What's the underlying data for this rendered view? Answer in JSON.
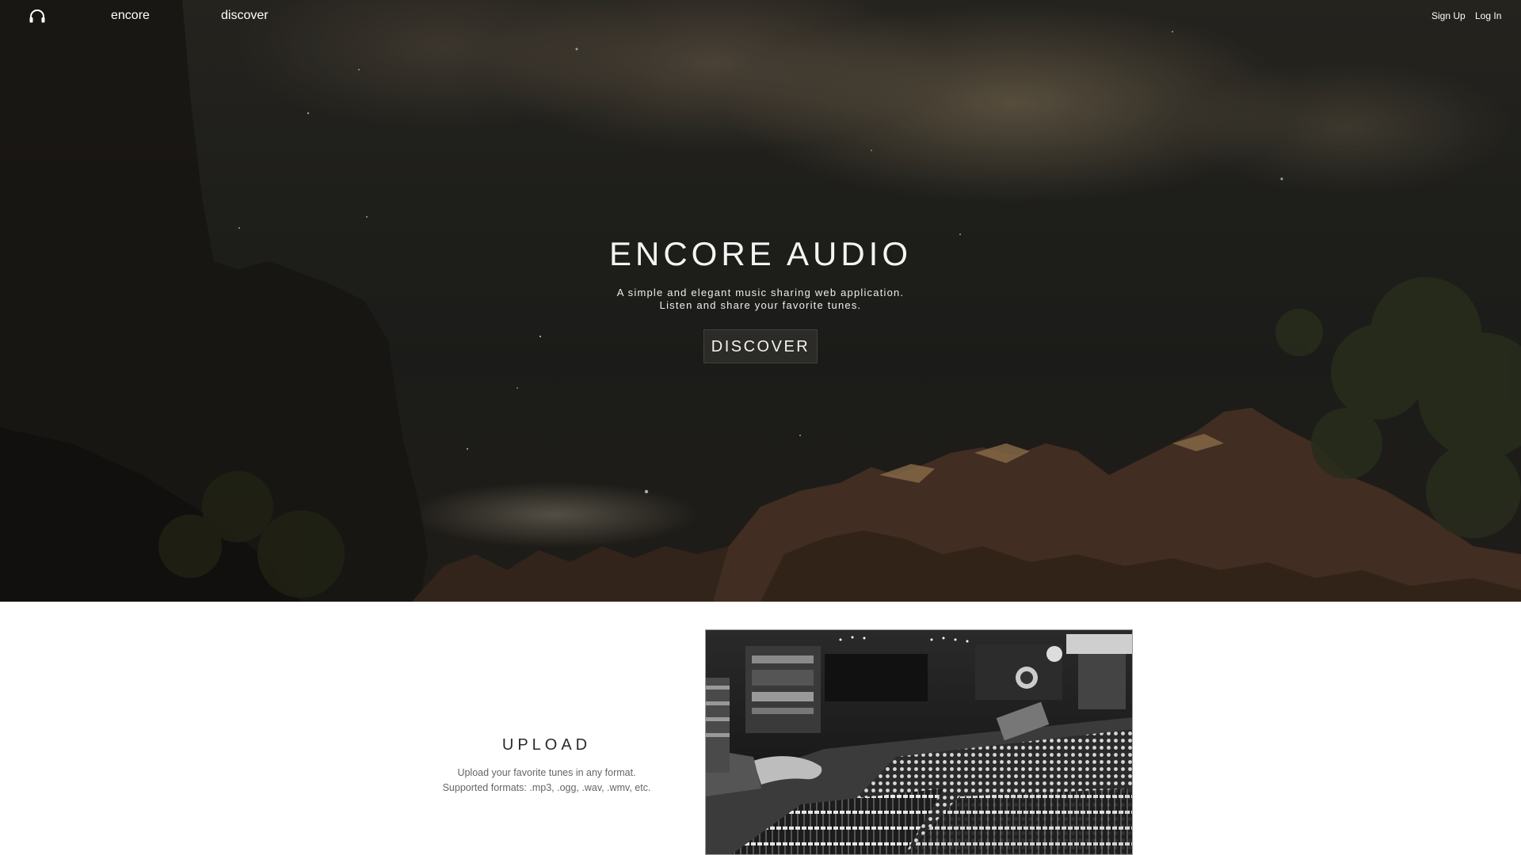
{
  "nav": {
    "logo_icon": "headphones-icon",
    "brand": "encore",
    "discover": "discover",
    "signup": "Sign Up",
    "login": "Log In"
  },
  "hero": {
    "title": "ENCORE AUDIO",
    "subtitle_line1": "A simple and elegant music sharing web application.",
    "subtitle_line2": "Listen and share your favorite tunes.",
    "button": "DISCOVER"
  },
  "upload": {
    "title": "UPLOAD",
    "desc_line1": "Upload your favorite tunes in any format.",
    "desc_line2": "Supported formats: .mp3, .ogg, .wav, .wmv, etc."
  },
  "colors": {
    "text_light": "#ffffff",
    "upload_title": "#2a2a2a",
    "upload_desc": "#666666"
  }
}
